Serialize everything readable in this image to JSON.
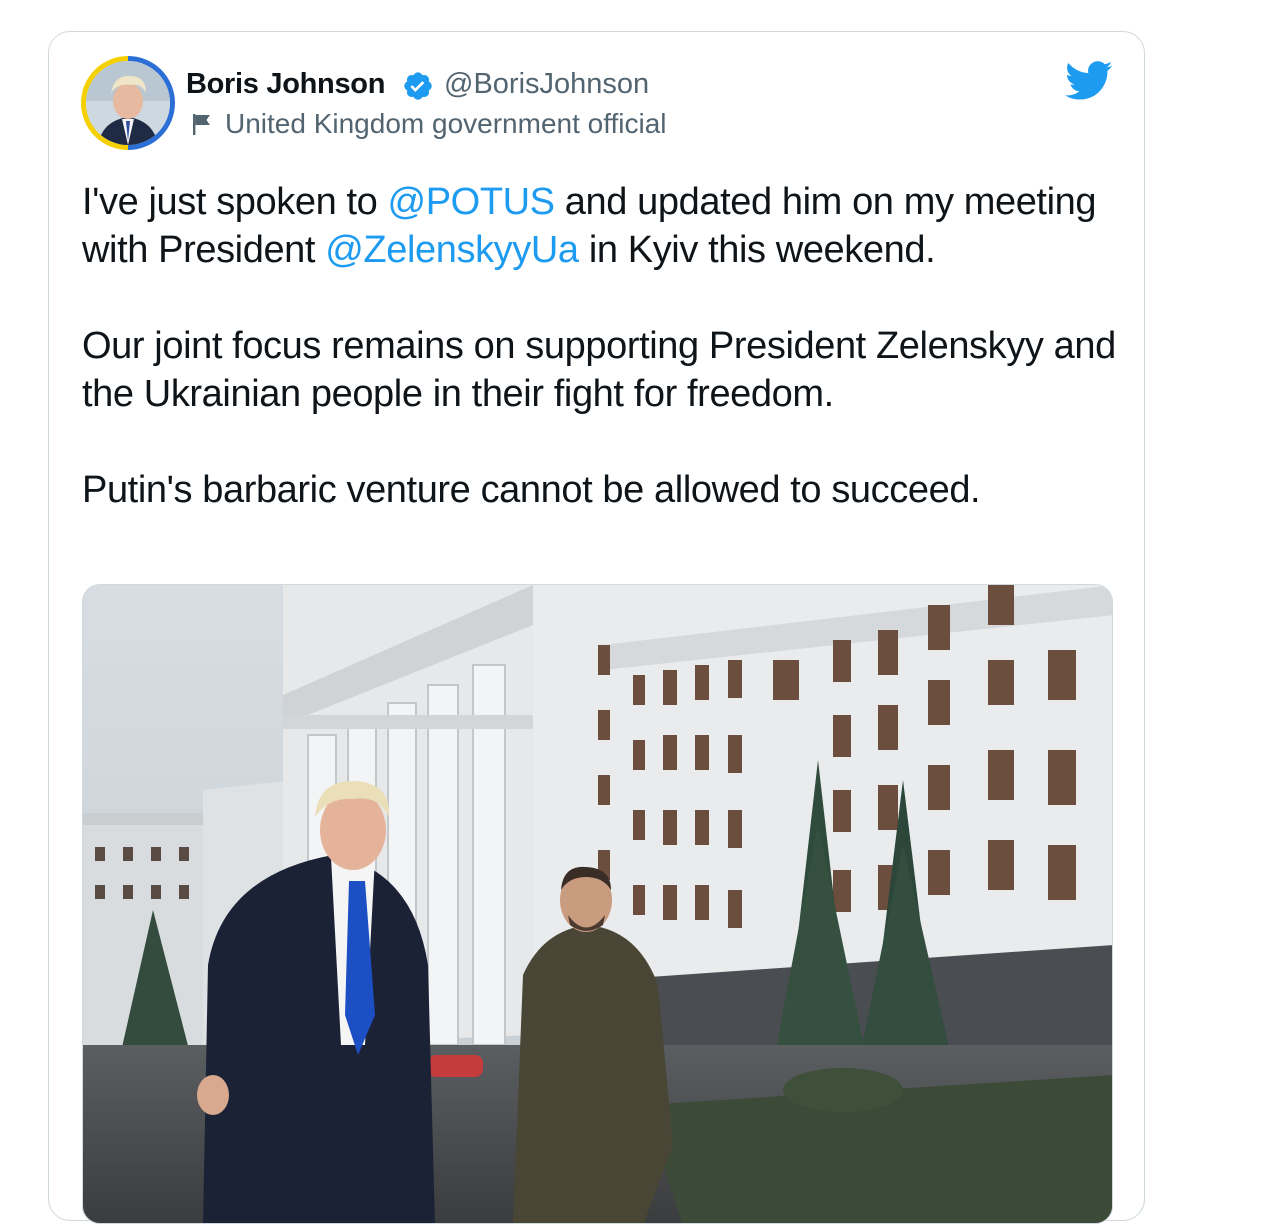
{
  "tweet": {
    "author_name": "Boris Johnson",
    "handle": "@BorisJohnson",
    "affiliation_label": "United Kingdom government official",
    "paragraph1": {
      "part1": "I've just spoken to ",
      "mention1": "@POTUS",
      "part2": " and updated him on my meeting with President ",
      "mention2": "@ZelenskyyUa",
      "part3": " in Kyiv this weekend."
    },
    "paragraph2": "Our joint focus remains on supporting President Zelenskyy and the Ukrainian people in their fight for freedom.",
    "paragraph3": "Putin's barbaric venture cannot be allowed to succeed.",
    "icons": {
      "verified": "verified-badge-icon",
      "affiliation": "flag-icon",
      "platform": "twitter-bird-icon"
    }
  },
  "colors": {
    "mention": "#1d9bf0",
    "text": "#0f1419",
    "secondary": "#536471",
    "border": "#cfd9de",
    "avatar_ring_blue": "#2b6fd6",
    "avatar_ring_yellow": "#f5d000"
  }
}
